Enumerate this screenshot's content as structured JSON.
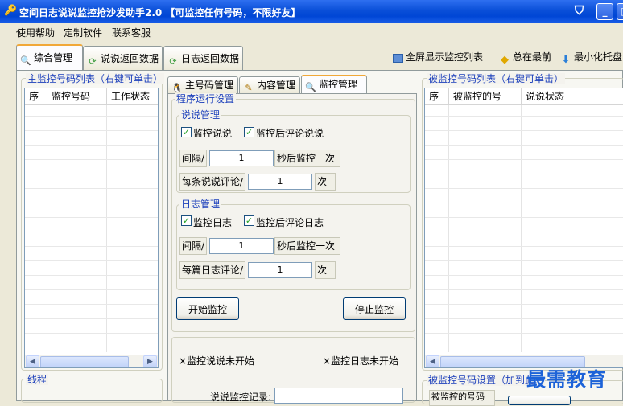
{
  "window": {
    "title": "空间日志说说监控抢沙发助手2.0 【可监控任何号码，不限好友】",
    "icons": [
      "app-icon",
      "shield-icon",
      "minimize-icon",
      "maximize-icon"
    ]
  },
  "menu": [
    "使用帮助",
    "定制软件",
    "联系客服"
  ],
  "main_tabs": [
    {
      "label": "综合管理",
      "icon": "search-icon",
      "active": true
    },
    {
      "label": "说说返回数据",
      "icon": "refresh-icon",
      "active": false
    },
    {
      "label": "日志返回数据",
      "icon": "refresh-icon",
      "active": false
    }
  ],
  "toolbar": {
    "fullscreen": "全屏显示监控列表",
    "always_top": "总在最前",
    "minimize_tray": "最小化托盘"
  },
  "left_list": {
    "title": "主监控号码列表（右键可单击）",
    "columns": [
      "序",
      "监控号码",
      "工作状态"
    ]
  },
  "thread_label": "线程",
  "inner_tabs": [
    {
      "label": "主号码管理",
      "icon": "qq-penguin-icon",
      "active": false
    },
    {
      "label": "内容管理",
      "icon": "pencil-icon",
      "active": false
    },
    {
      "label": "监控管理",
      "icon": "search-icon",
      "active": true
    }
  ],
  "settings": {
    "group_title": "程序运行设置",
    "shuoshuo": {
      "title": "说说管理",
      "monitor_label": "监控说说",
      "monitor_checked": true,
      "comment_label": "监控后评论说说",
      "comment_checked": true,
      "interval_label": "间隔/",
      "interval_value": "1",
      "interval_suffix": "秒后监控一次",
      "per_label": "每条说说评论/",
      "per_value": "1",
      "per_suffix": "次"
    },
    "rizhi": {
      "title": "日志管理",
      "monitor_label": "监控日志",
      "monitor_checked": true,
      "comment_label": "监控后评论日志",
      "comment_checked": true,
      "interval_label": "间隔/",
      "interval_value": "1",
      "interval_suffix": "秒后监控一次",
      "per_label": "每篇日志评论/",
      "per_value": "1",
      "per_suffix": "次"
    },
    "start_button": "开始监控",
    "stop_button": "停止监控"
  },
  "status": {
    "shuoshuo": "×监控说说未开始",
    "rizhi": "×监控日志未开始",
    "record_label": "说说监控记录:"
  },
  "right_list": {
    "title": "被监控号码列表（右键可单击）",
    "columns": [
      "序",
      "被监控的号",
      "说说状态"
    ]
  },
  "right_settings": {
    "title": "被监控号码设置（加到此...",
    "field_label": "被监控的号码"
  },
  "watermark": "最需教育",
  "colors": {
    "title_bar": "#0a4fd8",
    "group_label": "#1b3fbb",
    "watermark": "#1d63d8"
  }
}
